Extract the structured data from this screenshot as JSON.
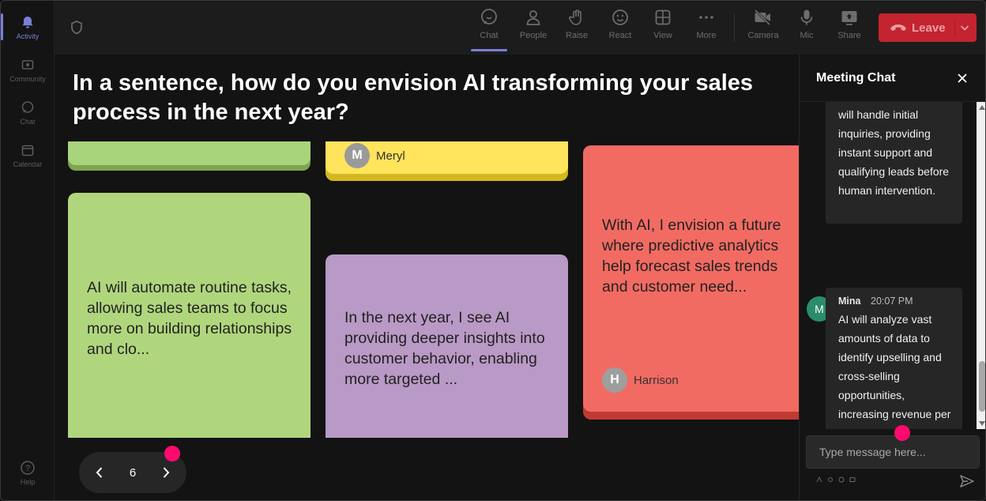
{
  "rail": {
    "items": [
      {
        "label": "Activity",
        "icon": "bell-icon",
        "active": true
      },
      {
        "label": "Community",
        "icon": "community-icon"
      },
      {
        "label": "Chat",
        "icon": "chat-icon"
      },
      {
        "label": "Calendar",
        "icon": "calendar-icon"
      }
    ],
    "help": {
      "label": "Help",
      "icon": "help-icon"
    }
  },
  "toolbar": {
    "buttons": [
      {
        "label": "Chat",
        "icon": "chat-icon",
        "active": true
      },
      {
        "label": "People",
        "icon": "people-icon"
      },
      {
        "label": "Raise",
        "icon": "raise-hand-icon"
      },
      {
        "label": "React",
        "icon": "react-icon"
      },
      {
        "label": "View",
        "icon": "view-icon"
      },
      {
        "label": "More",
        "icon": "more-icon"
      },
      {
        "label": "Camera",
        "icon": "camera-off-icon"
      },
      {
        "label": "Mic",
        "icon": "mic-icon"
      },
      {
        "label": "Share",
        "icon": "share-icon"
      }
    ],
    "leave_label": "Leave"
  },
  "board": {
    "question": "In a sentence, how do you envision AI transforming your sales process in the next year?",
    "cards": [
      {
        "color": "#a8d47b",
        "shadow": "#7fa54e",
        "text": "",
        "author": "",
        "initial": ""
      },
      {
        "color": "#ffe45c",
        "shadow": "#d4b820",
        "text": "",
        "author": "Meryl",
        "initial": "M"
      },
      {
        "color": "#f26b63",
        "shadow": "#c03a33",
        "text": "With AI, I envision a future where predictive analytics help forecast sales trends and customer need...",
        "author": "Harrison",
        "initial": "H"
      },
      {
        "color": "#b0d67d",
        "shadow": "#7fa54e",
        "text": "AI will automate routine tasks, allowing sales teams to focus more on building relationships and clo...",
        "author": "",
        "initial": ""
      },
      {
        "color": "#b999c5",
        "shadow": "#8b6d99",
        "text": "In the next year, I see AI providing deeper insights into customer behavior, enabling more targeted ...",
        "author": "",
        "initial": ""
      }
    ],
    "page": "6"
  },
  "chat": {
    "title": "Meeting Chat",
    "messages": [
      {
        "author": "",
        "time": "",
        "text": "will handle initial inquiries, providing instant support and qualifying leads before human intervention."
      },
      {
        "author": "Mina",
        "time": "20:07 PM",
        "initial": "M",
        "text": "AI will analyze vast amounts of data to identify upselling and cross-selling opportunities, increasing revenue per customer."
      }
    ],
    "compose_placeholder": "Type message here..."
  },
  "colors": {
    "accent": "#7b7fd6",
    "leave": "#c4242f",
    "marker": "#ff0a6e"
  }
}
